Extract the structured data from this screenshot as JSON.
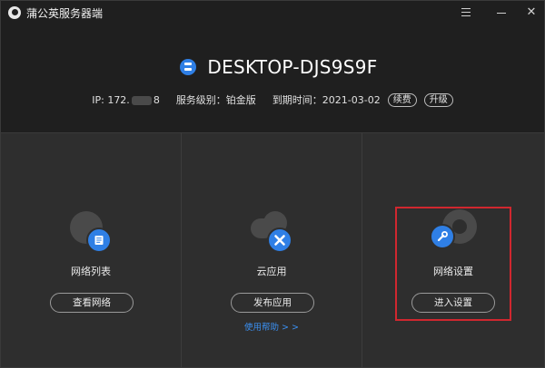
{
  "titlebar": {
    "title": "蒲公英服务器端",
    "menu_icon": "menu-icon",
    "minimize_icon": "minimize-icon",
    "close_label": "✕"
  },
  "device": {
    "icon": "server-icon",
    "name": "DESKTOP-DJS9S9F"
  },
  "info": {
    "ip_label": "IP: 172.",
    "ip_suffix": "8",
    "service_level": "服务级别：铂金版",
    "expiry": "到期时间：2021-03-02",
    "renew_label": "续费",
    "upgrade_label": "升级"
  },
  "panels": [
    {
      "icon": "network-list-icon",
      "label": "网络列表",
      "button": "查看网络"
    },
    {
      "icon": "cloud-app-icon",
      "label": "云应用",
      "button": "发布应用",
      "help_link": "使用帮助 > >"
    },
    {
      "icon": "network-settings-icon",
      "label": "网络设置",
      "button": "进入设置"
    }
  ],
  "colors": {
    "accent": "#2f7fe5",
    "highlight": "#d0272f",
    "background": "#1f1f1f",
    "panel": "#2e2e2e"
  }
}
